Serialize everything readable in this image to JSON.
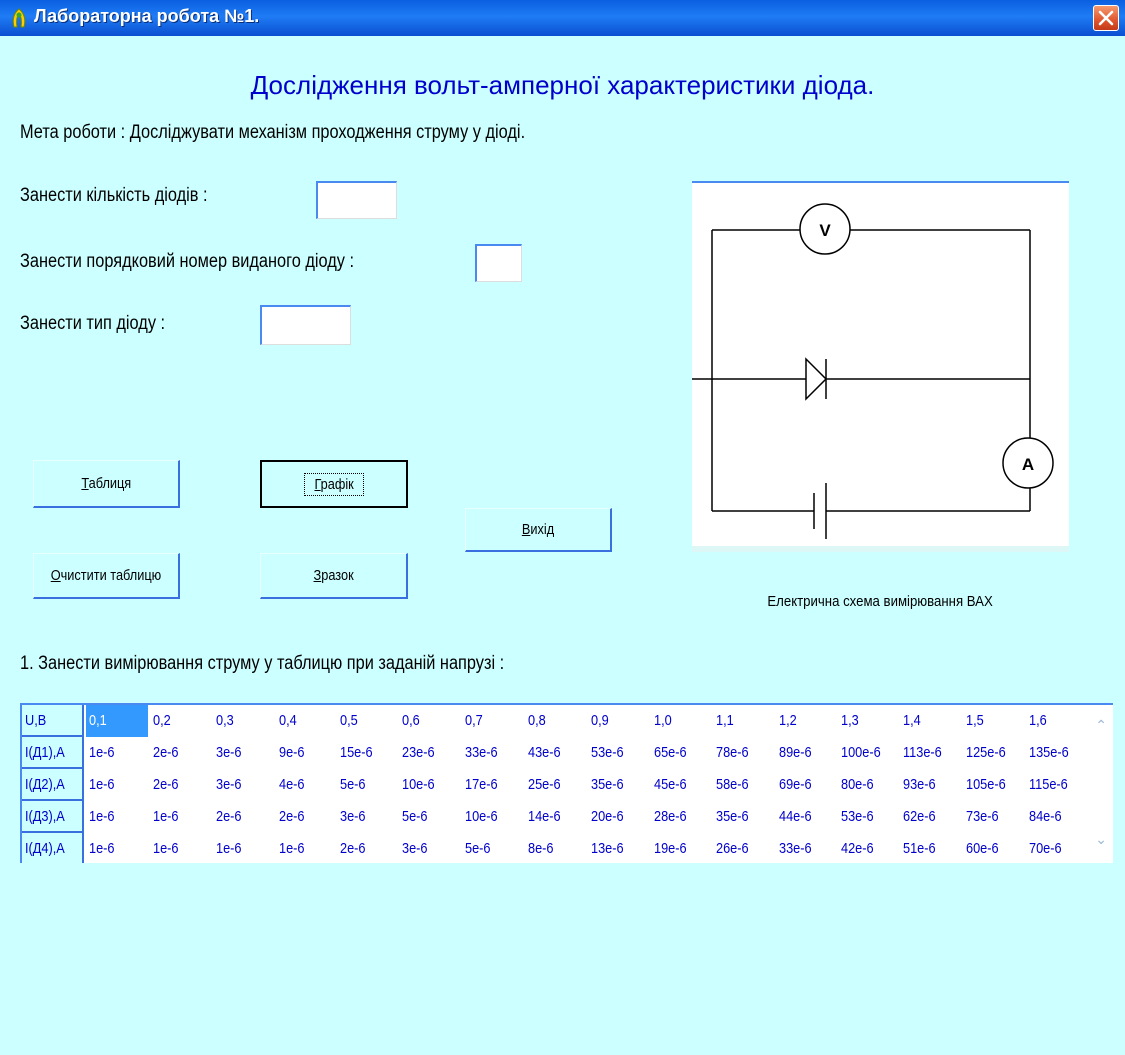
{
  "window": {
    "title": "Лабораторна робота №1."
  },
  "heading": "Дослідження вольт-амперної характеристики діода.",
  "goal": "Мета роботи :  Досліджувати механізм проходження струму у діоді.",
  "form": {
    "count_label": "Занести кількість діодів :",
    "count_value": "",
    "number_label": "Занести порядковий номер виданого діоду :",
    "number_value": "",
    "type_label": "Занести тип діоду :",
    "type_value": ""
  },
  "buttons": {
    "table": {
      "acc": "Т",
      "rest": "аблиця"
    },
    "graph": {
      "acc": "Г",
      "rest": "рафік"
    },
    "exit": {
      "acc": "В",
      "rest": "ихід"
    },
    "clear": {
      "acc": "О",
      "rest": "чистити таблицю"
    },
    "sample": {
      "acc": "З",
      "rest": "разок"
    }
  },
  "diagram": {
    "caption": "Електрична схема вимірювання ВАХ",
    "voltmeter": "V",
    "ammeter": "A"
  },
  "instruction": "1. Занести вимірювання струму у таблицю при заданій напрузі :",
  "table": {
    "rows": [
      {
        "header": "U,B",
        "values": [
          "0,1",
          "0,2",
          "0,3",
          "0,4",
          "0,5",
          "0,6",
          "0,7",
          "0,8",
          "0,9",
          "1,0",
          "1,1",
          "1,2",
          "1,3",
          "1,4",
          "1,5",
          "1,6"
        ]
      },
      {
        "header": "I(Д1),A",
        "values": [
          "1e-6",
          "2e-6",
          "3e-6",
          "9e-6",
          "15e-6",
          "23e-6",
          "33e-6",
          "43e-6",
          "53e-6",
          "65e-6",
          "78e-6",
          "89e-6",
          "100e-6",
          "113e-6",
          "125e-6",
          "135e-6"
        ]
      },
      {
        "header": "I(Д2),A",
        "values": [
          "1e-6",
          "2e-6",
          "3e-6",
          "4e-6",
          "5e-6",
          "10e-6",
          "17e-6",
          "25e-6",
          "35e-6",
          "45e-6",
          "58e-6",
          "69e-6",
          "80e-6",
          "93e-6",
          "105e-6",
          "115e-6"
        ]
      },
      {
        "header": "I(Д3),A",
        "values": [
          "1e-6",
          "1e-6",
          "2e-6",
          "2e-6",
          "3e-6",
          "5e-6",
          "10e-6",
          "14e-6",
          "20e-6",
          "28e-6",
          "35e-6",
          "44e-6",
          "53e-6",
          "62e-6",
          "73e-6",
          "84e-6"
        ]
      },
      {
        "header": "I(Д4),A",
        "values": [
          "1e-6",
          "1e-6",
          "1e-6",
          "1e-6",
          "2e-6",
          "3e-6",
          "5e-6",
          "8e-6",
          "13e-6",
          "19e-6",
          "26e-6",
          "33e-6",
          "42e-6",
          "51e-6",
          "60e-6",
          "70e-6"
        ]
      }
    ]
  },
  "colors": {
    "background": "#ccffff",
    "titlebar": "#0b5ce0",
    "accent": "#0000cc",
    "selection": "#3399ff"
  }
}
